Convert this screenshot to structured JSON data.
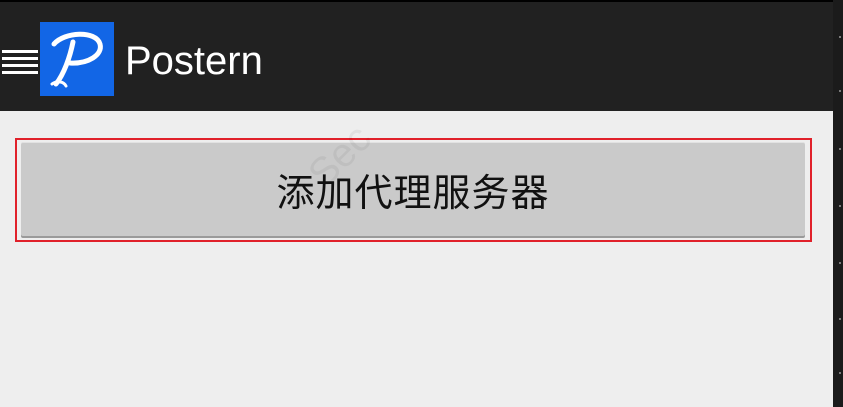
{
  "app": {
    "title": "Postern",
    "logo_letter": "P",
    "logo_color": "#1266e6",
    "bar_color": "#212121",
    "background_color": "#eeeeee"
  },
  "menu": {
    "icon": "hamburger-menu-icon"
  },
  "main": {
    "add_proxy_label": "添加代理服务器",
    "highlight_color": "#e0202a"
  },
  "watermark": {
    "text": "Sec"
  }
}
